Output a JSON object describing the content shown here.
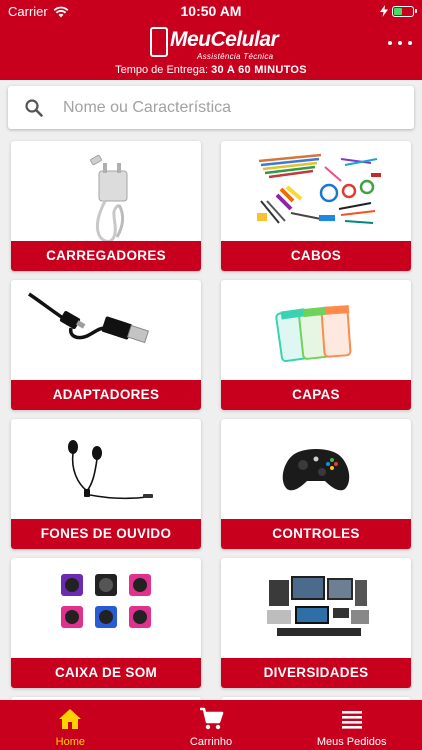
{
  "status_bar": {
    "carrier": "Carrier",
    "time": "10:50 AM"
  },
  "header": {
    "logo_text": "MeuCelular",
    "logo_subtitle": "Assistência Técnica",
    "delivery_prefix": "Tempo de Entrega:",
    "delivery_value": "30 A 60 MINUTOS"
  },
  "search": {
    "placeholder": "Nome ou Característica",
    "value": ""
  },
  "categories": [
    {
      "label": "CARREGADORES",
      "icon": "charger-image"
    },
    {
      "label": "CABOS",
      "icon": "cables-image"
    },
    {
      "label": "ADAPTADORES",
      "icon": "usb-adapter-image"
    },
    {
      "label": "CAPAS",
      "icon": "phone-cases-image"
    },
    {
      "label": "FONES DE OUVIDO",
      "icon": "earphones-image"
    },
    {
      "label": "CONTROLES",
      "icon": "game-controller-image"
    },
    {
      "label": "CAIXA DE SOM",
      "icon": "speakers-image"
    },
    {
      "label": "DIVERSIDADES",
      "icon": "electronics-image"
    }
  ],
  "tabbar": [
    {
      "label": "Home",
      "icon": "home-icon",
      "active": true
    },
    {
      "label": "Carrinho",
      "icon": "cart-icon",
      "active": false
    },
    {
      "label": "Meus Pedidos",
      "icon": "list-icon",
      "active": false
    }
  ],
  "colors": {
    "brand_red": "#c8001e",
    "active_tab": "#ffd100",
    "background": "#efefef"
  }
}
